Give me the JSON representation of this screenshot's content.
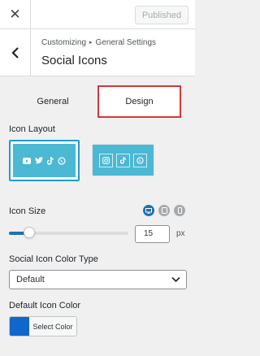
{
  "topbar": {
    "close_icon": "close-icon",
    "publish_label": "Published"
  },
  "header": {
    "breadcrumb_root": "Customizing",
    "breadcrumb_section": "General Settings",
    "title": "Social Icons"
  },
  "tabs": [
    {
      "label": "General",
      "active": false
    },
    {
      "label": "Design",
      "active": true
    }
  ],
  "icon_layout": {
    "label": "Icon Layout",
    "options": [
      {
        "name": "layout-filled",
        "icons": [
          "youtube-icon",
          "twitter-icon",
          "tiktok-icon",
          "whatsapp-icon"
        ],
        "selected": true
      },
      {
        "name": "layout-outlined",
        "icons": [
          "instagram-icon",
          "tiktok-icon",
          "whatsapp-icon"
        ],
        "selected": false
      }
    ],
    "preview_color": "#4bb8d4"
  },
  "icon_size": {
    "label": "Icon Size",
    "value": "15",
    "unit": "px",
    "slider_fraction": 0.17,
    "devices": [
      "desktop-icon",
      "tablet-icon",
      "mobile-icon"
    ]
  },
  "color_type": {
    "label": "Social Icon Color Type",
    "selected": "Default"
  },
  "default_color": {
    "label": "Default Icon Color",
    "button_label": "Select Color",
    "swatch": "#1166cc"
  },
  "colors": {
    "accent": "#2271b1",
    "annotation": "#d63638"
  }
}
